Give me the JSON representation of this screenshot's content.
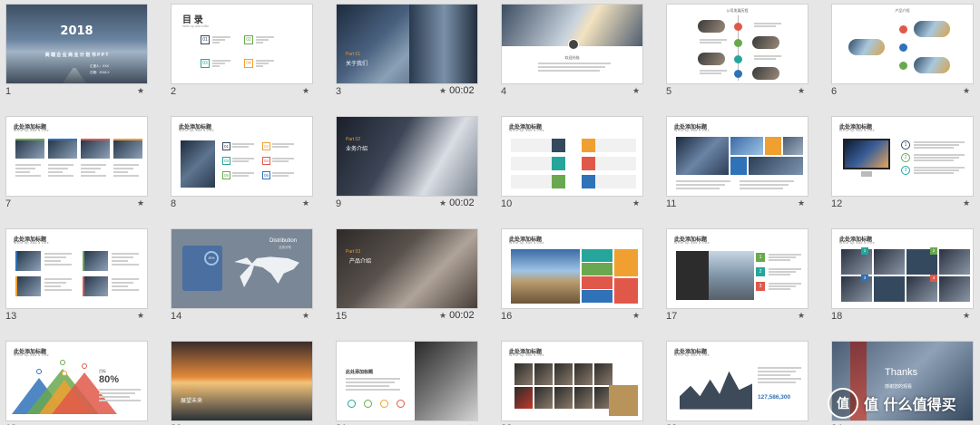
{
  "slides": [
    {
      "number": "1",
      "title": "2018",
      "subtitle": "商 端 企 业 商 业 计 划 书 P P T",
      "line1": "汇报人：XXX",
      "line2": "日期：2018.X"
    },
    {
      "number": "2",
      "title": "目 录",
      "subtitle": "Write up add a title",
      "items": [
        "01",
        "02",
        "03",
        "04"
      ]
    },
    {
      "number": "3",
      "part": "Part 01",
      "caption": "关于我们",
      "timing": "00:02"
    },
    {
      "number": "4",
      "caption": "欢迎光临"
    },
    {
      "number": "5",
      "title": "公司发展历程"
    },
    {
      "number": "6",
      "title": "产品介绍"
    },
    {
      "number": "7",
      "title": "此处添加标题",
      "subtitle": "Write up add a title"
    },
    {
      "number": "8",
      "title": "此处添加标题",
      "subtitle": "Write up add a title",
      "items": [
        "01",
        "02",
        "03",
        "04",
        "05",
        "06"
      ]
    },
    {
      "number": "9",
      "part": "Part 02",
      "caption": "业务介绍",
      "timing": "00:02"
    },
    {
      "number": "10",
      "title": "此处添加标题",
      "subtitle": "Write up add a title"
    },
    {
      "number": "11",
      "title": "此处添加标题",
      "subtitle": "Write up add a title"
    },
    {
      "number": "12",
      "title": "此处添加标题",
      "subtitle": "Write up add a title",
      "items": [
        "1",
        "2",
        "3"
      ]
    },
    {
      "number": "13",
      "title": "此处添加标题",
      "subtitle": "Write up add a title"
    },
    {
      "number": "14",
      "title": "Distribution",
      "subtitle": "业务分布",
      "value": "20%"
    },
    {
      "number": "15",
      "part": "Part 03",
      "caption": "产品介绍",
      "timing": "00:02"
    },
    {
      "number": "16",
      "title": "此处添加标题",
      "subtitle": "Write up add a title"
    },
    {
      "number": "17",
      "title": "此处添加标题",
      "subtitle": "Write up add a title",
      "items": [
        "1",
        "2",
        "3"
      ]
    },
    {
      "number": "18",
      "title": "此处添加标题",
      "subtitle": "Write up add a title",
      "items": [
        "1",
        "2",
        "3",
        "4"
      ]
    },
    {
      "number": "19",
      "title": "此处添加标题",
      "subtitle": "Write up add a title",
      "label": "目标",
      "value": "80%"
    },
    {
      "number": "20",
      "part": "Part 04",
      "caption": "展望未来"
    },
    {
      "number": "21",
      "title": "此处添加标题"
    },
    {
      "number": "22",
      "title": "此处添加标题",
      "subtitle": "Write up add a title"
    },
    {
      "number": "23",
      "title": "此处添加标题",
      "subtitle": "Write up add a title",
      "value": "127,586,300"
    },
    {
      "number": "24",
      "title": "Thanks",
      "subtitle": "感谢您的观看"
    }
  ],
  "star_glyph": "★",
  "colors": {
    "accent_orange": "#e59a3a",
    "green": "#6aa84f",
    "teal": "#26a69a",
    "red": "#e0584a",
    "blue": "#2f72b8"
  },
  "watermark_text": "值 什么值得买"
}
